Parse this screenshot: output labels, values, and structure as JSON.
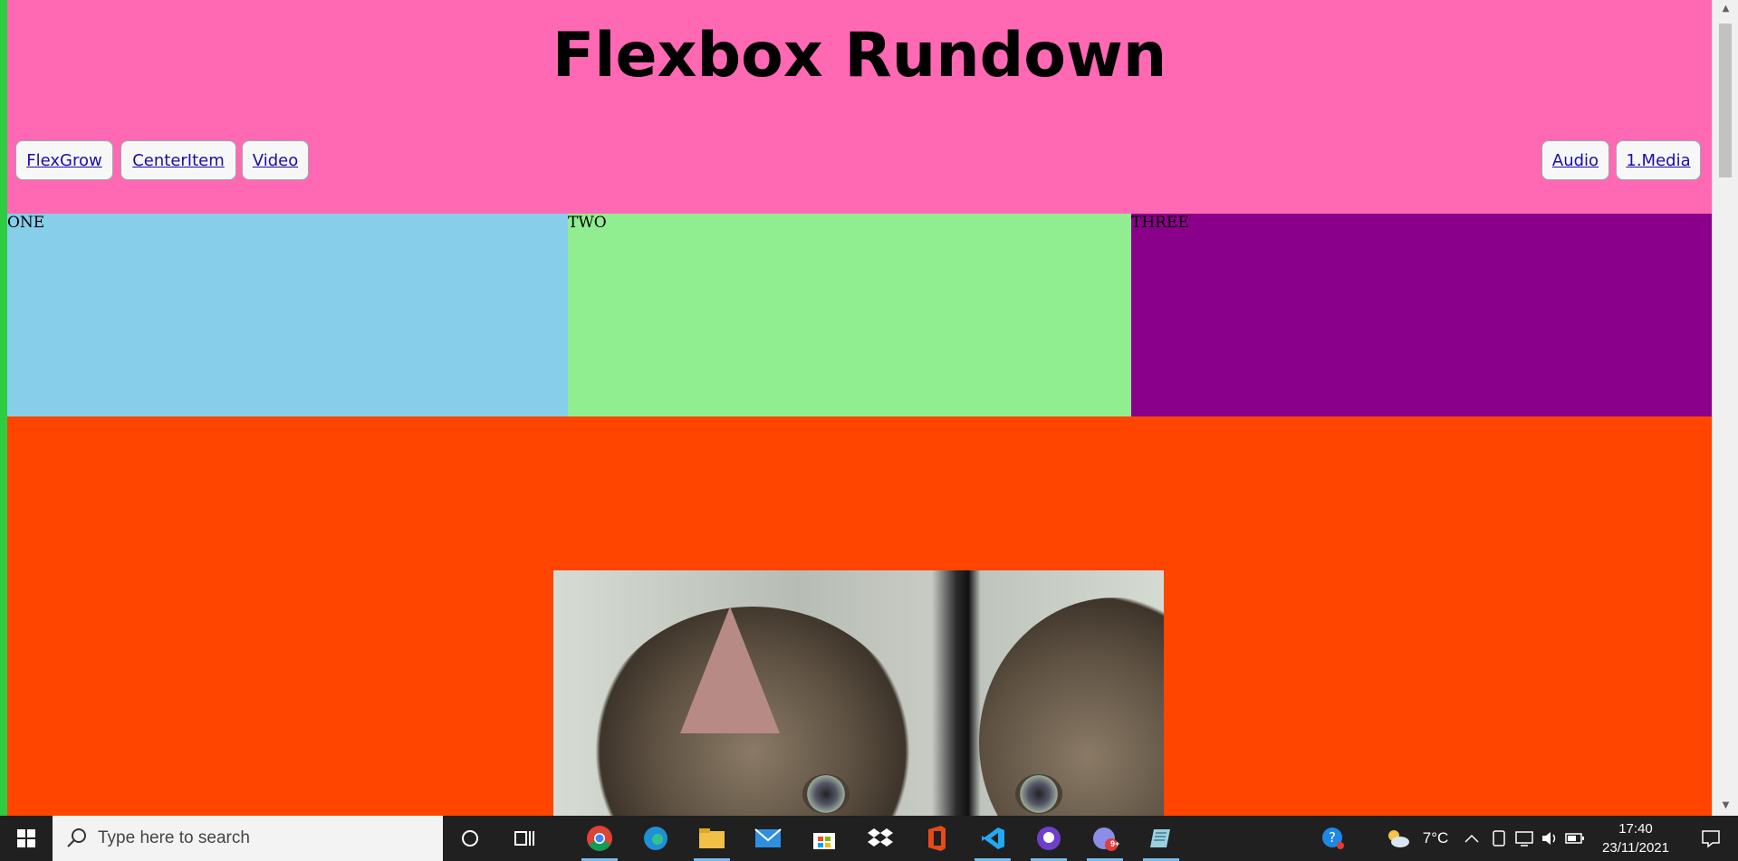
{
  "page": {
    "title": "Flexbox Rundown",
    "nav_left": [
      "FlexGrow",
      "CenterItem",
      "Video"
    ],
    "nav_right": [
      "Audio",
      "1.Media"
    ],
    "boxes": [
      "ONE",
      "TWO",
      "THREE"
    ],
    "colors": {
      "header": "#ff69b4",
      "box_one": "#87ceeb",
      "box_two": "#90ee90",
      "box_three": "#8b008b",
      "body": "#ff4500"
    },
    "image_subject": "kitten photo"
  },
  "taskbar": {
    "search_placeholder": "Type here to search",
    "apps": [
      "cortana-icon",
      "task-view-icon",
      "chrome-icon",
      "edge-icon",
      "file-explorer-icon",
      "mail-icon",
      "store-icon",
      "dropbox-icon",
      "office-icon",
      "vscode-icon",
      "github-icon",
      "discord-icon",
      "notepad-icon"
    ],
    "discord_badge": "9+",
    "temperature": "7°C",
    "time": "17:40",
    "date": "23/11/2021"
  }
}
